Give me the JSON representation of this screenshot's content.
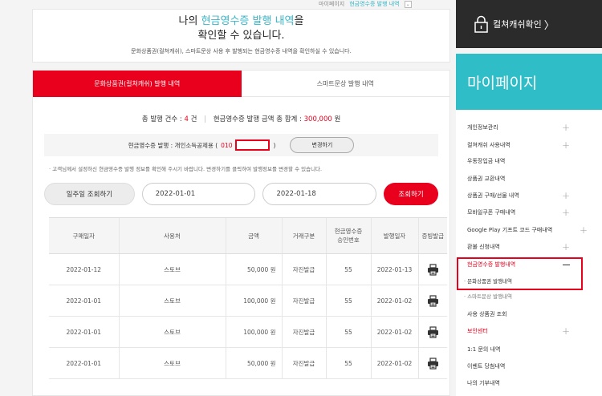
{
  "breadcrumb": {
    "parent": "마이페이지",
    "current": "현금영수증 발행 내역",
    "toggle": "⌄"
  },
  "header": {
    "title_pre": "나의 ",
    "title_highlight": "현금영수증 발행 내역",
    "title_post": "을",
    "title_line2": "확인할 수 있습니다.",
    "description": "문화상품권(컬쳐캐쉬), 스마트문상 사용 후 발행되는 현금영수증 내역을 확인하실 수 있습니다."
  },
  "tabs": [
    {
      "label": "문화상품권(컬쳐캐쉬) 발행 내역",
      "active": true
    },
    {
      "label": "스마트문상 발행 내역",
      "active": false
    }
  ],
  "summary": {
    "count_label": "총 발행 건수 : ",
    "count_value": "4",
    "count_unit": " 건",
    "sum_label": "현금영수증 발행 금액 총 합계 : ",
    "sum_value": "300,000",
    "sum_unit": " 원"
  },
  "issue": {
    "label": "현금영수증 발행 : 개인소득공제용 ( ",
    "phone_prefix": "010",
    "close": " )",
    "change_button": "변경하기"
  },
  "notice": "· 고객님께서 설정하신 현금영수증 발행 정보를 확인해 주시기 바랍니다. 변경하기를 클릭하여 발행정보를 변경할 수 있습니다.",
  "search": {
    "week_button": "일주일 조회하기",
    "start_date": "2022-01-01",
    "end_date": "2022-01-18",
    "search_button": "조회하기"
  },
  "table": {
    "headers": [
      "구매일자",
      "사용처",
      "금액",
      "거래구분",
      "현금영수증\n승인번호",
      "발행일자",
      "증빙발급"
    ],
    "rows": [
      [
        "2022-01-12",
        "스토브",
        "50,000 원",
        "자진발급",
        "55",
        "2022-01-13"
      ],
      [
        "2022-01-01",
        "스토브",
        "100,000 원",
        "자진발급",
        "55",
        "2022-01-02"
      ],
      [
        "2022-01-01",
        "스토브",
        "100,000 원",
        "자진발급",
        "55",
        "2022-01-02"
      ],
      [
        "2022-01-01",
        "스토브",
        "50,000 원",
        "자진발급",
        "55",
        "2022-01-02"
      ]
    ]
  },
  "culture_box": {
    "label": "컬쳐캐쉬확인",
    "arrow": "〉"
  },
  "mypage_title": "마이페이지",
  "side_nav": {
    "items": [
      {
        "label": "개인정보관리",
        "plus": "+"
      },
      {
        "label": "컬쳐캐쉬 사용내역",
        "plus": "+"
      },
      {
        "label": "우동장입금 내역",
        "plus": ""
      },
      {
        "label": "상품권 교환내역",
        "plus": ""
      },
      {
        "label": "상품권 구매/선물 내역",
        "plus": "+"
      },
      {
        "label": "모바일쿠폰 구매내역",
        "plus": "+"
      },
      {
        "label": "Google Play 기프트 코드 구매내역",
        "plus": "+"
      },
      {
        "label": "환불 신청내역",
        "plus": "+"
      },
      {
        "label": "현금영수증 발행내역",
        "plus": ""
      },
      {
        "label": "사용 상품권 조회",
        "plus": ""
      },
      {
        "label": "보안센터",
        "plus": "+"
      },
      {
        "label": "1:1 문의 내역",
        "plus": ""
      },
      {
        "label": "이벤트 당첨내역",
        "plus": ""
      },
      {
        "label": "나의 기부내역",
        "plus": ""
      }
    ],
    "sub_items": [
      "· 문화상품권 발행내역",
      "· 스마트문상 발행내역"
    ]
  }
}
